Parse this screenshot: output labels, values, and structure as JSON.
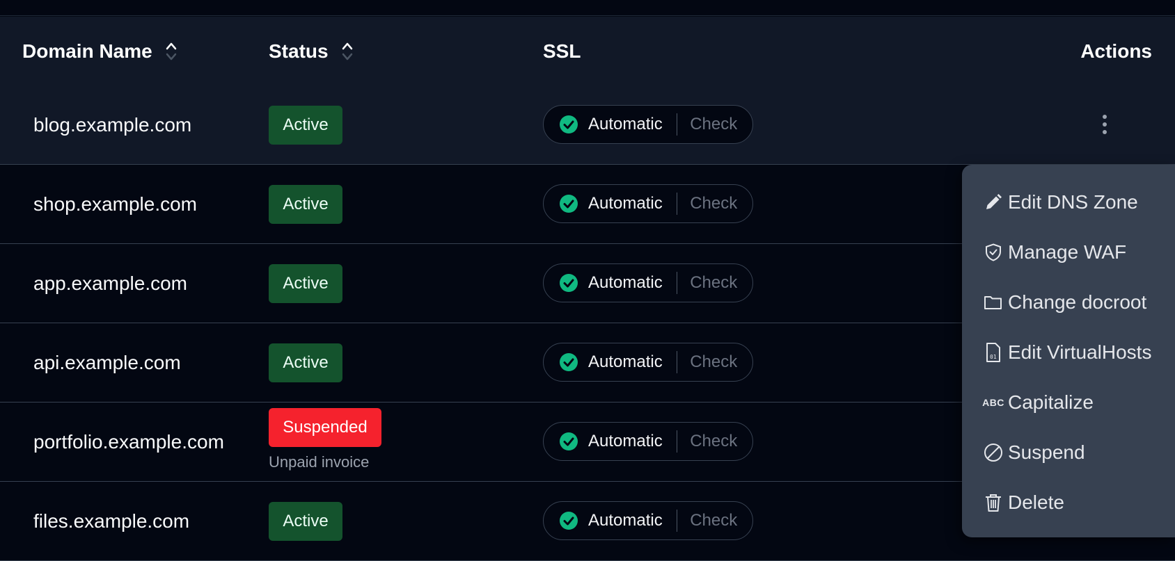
{
  "columns": {
    "domain": "Domain Name",
    "status": "Status",
    "ssl": "SSL",
    "actions": "Actions"
  },
  "rows": [
    {
      "domain": "blog.example.com",
      "status": "Active",
      "status_note": "",
      "ssl_mode": "Automatic",
      "ssl_action": "Check"
    },
    {
      "domain": "shop.example.com",
      "status": "Active",
      "status_note": "",
      "ssl_mode": "Automatic",
      "ssl_action": "Check"
    },
    {
      "domain": "app.example.com",
      "status": "Active",
      "status_note": "",
      "ssl_mode": "Automatic",
      "ssl_action": "Check"
    },
    {
      "domain": "api.example.com",
      "status": "Active",
      "status_note": "",
      "ssl_mode": "Automatic",
      "ssl_action": "Check"
    },
    {
      "domain": "portfolio.example.com",
      "status": "Suspended",
      "status_note": "Unpaid invoice",
      "ssl_mode": "Automatic",
      "ssl_action": "Check"
    },
    {
      "domain": "files.example.com",
      "status": "Active",
      "status_note": "",
      "ssl_mode": "Automatic",
      "ssl_action": "Check"
    }
  ],
  "actions_menu": {
    "items": [
      {
        "label": "Edit DNS Zone",
        "icon": "pencil-icon"
      },
      {
        "label": "Manage WAF",
        "icon": "shield-check-icon"
      },
      {
        "label": "Change docroot",
        "icon": "folder-icon"
      },
      {
        "label": "Edit VirtualHosts",
        "icon": "file-binary-icon"
      },
      {
        "label": "Capitalize",
        "icon": "abc-icon"
      },
      {
        "label": "Suspend",
        "icon": "slash-circle-icon"
      },
      {
        "label": "Delete",
        "icon": "trash-icon"
      }
    ],
    "abc_glyph": "ABC"
  },
  "colors": {
    "active_badge": "#14532d",
    "suspended_badge": "#f5222d",
    "ssl_ok": "#10b981",
    "menu_bg": "#374151",
    "header_bg": "#111827",
    "page_bg": "#030712"
  }
}
